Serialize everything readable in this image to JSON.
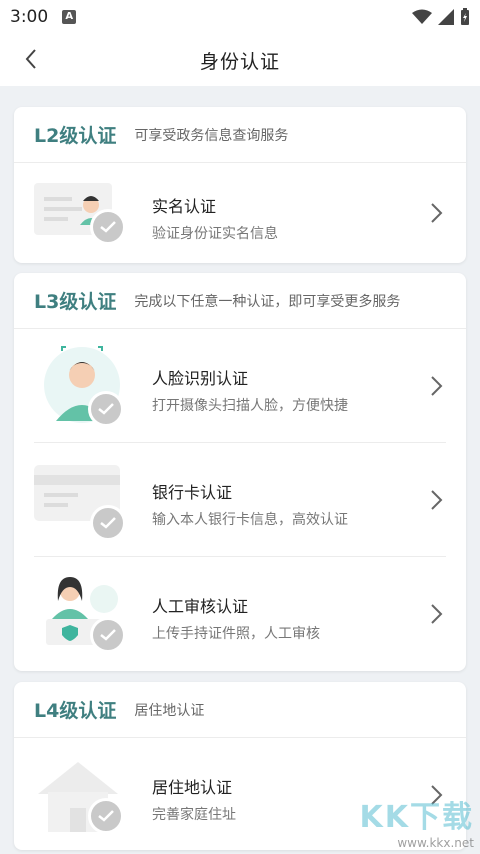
{
  "status_bar": {
    "time": "3:00"
  },
  "header": {
    "title": "身份认证"
  },
  "sections": [
    {
      "level": "L2级认证",
      "description": "可享受政务信息查询服务",
      "items": [
        {
          "name": "实名认证",
          "desc": "验证身份证实名信息"
        }
      ]
    },
    {
      "level": "L3级认证",
      "description": "完成以下任意一种认证，即可享受更多服务",
      "items": [
        {
          "name": "人脸识别认证",
          "desc": "打开摄像头扫描人脸，方便快捷"
        },
        {
          "name": "银行卡认证",
          "desc": "输入本人银行卡信息，高效认证"
        },
        {
          "name": "人工审核认证",
          "desc": "上传手持证件照，人工审核"
        }
      ]
    },
    {
      "level": "L4级认证",
      "description": "居住地认证",
      "items": [
        {
          "name": "居住地认证",
          "desc": "完善家庭住址"
        }
      ]
    }
  ],
  "watermark": {
    "text": "KK下载",
    "url": "www.kkx.net"
  },
  "colors": {
    "accent": "#3f7f80",
    "background": "#eef1f4",
    "check_badge": "#c9c9c9"
  }
}
